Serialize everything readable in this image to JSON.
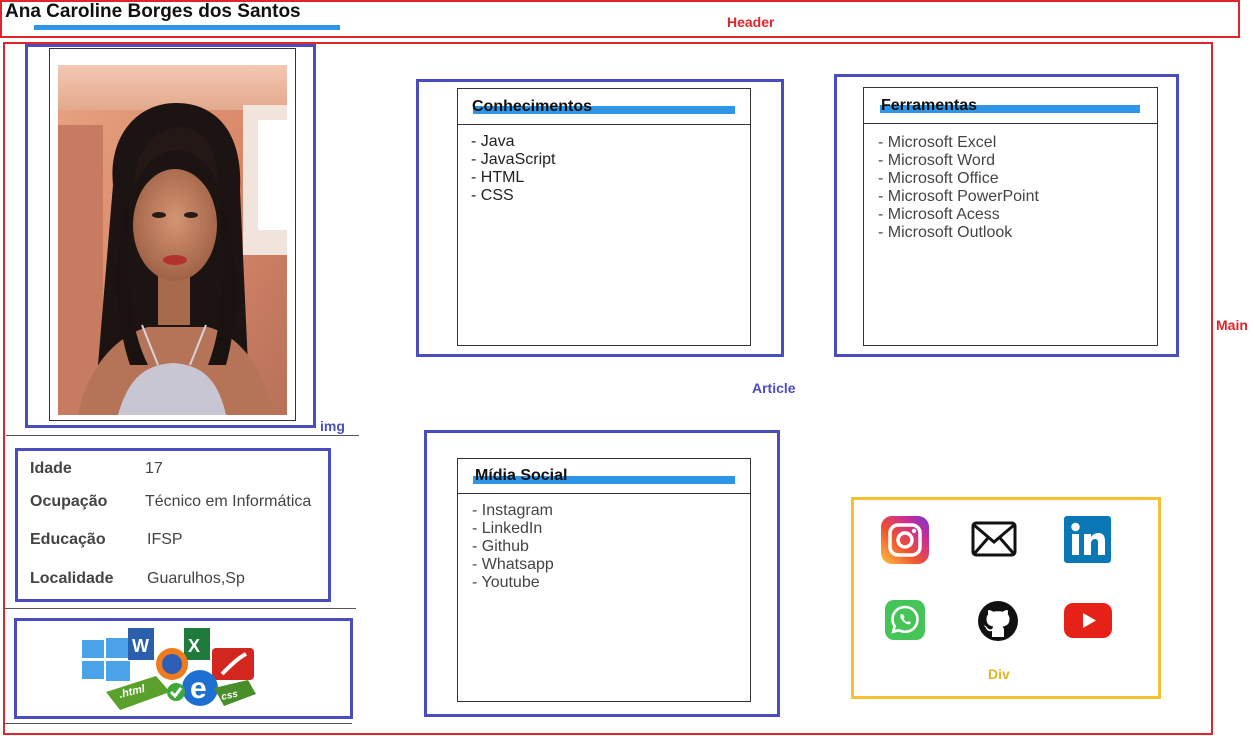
{
  "header": {
    "name": "Ana Caroline Borges dos Santos",
    "label": "Header"
  },
  "labels": {
    "main": "Main",
    "article": "Article",
    "img": "img",
    "div": "Div"
  },
  "info": [
    {
      "key": "Idade",
      "value": "17"
    },
    {
      "key": "Ocupação",
      "value": "Técnico em Informática"
    },
    {
      "key": "Educação",
      "value": "IFSP"
    },
    {
      "key": "Localidade",
      "value": "Guarulhos,Sp"
    }
  ],
  "cards": {
    "conhecimentos": {
      "title": "Conhecimentos",
      "items": [
        "- Java",
        "- JavaScript",
        "- HTML",
        "- CSS"
      ]
    },
    "ferramentas": {
      "title": "Ferramentas",
      "items": [
        "- Microsoft Excel",
        "- Microsoft Word",
        "- Microsoft Office",
        "- Microsoft PowerPoint",
        "- Microsoft Acess",
        "- Microsoft Outlook"
      ]
    },
    "midia": {
      "title": "Mídia Social",
      "items": [
        "- Instagram",
        "- LinkedIn",
        "- Github",
        "- Whatsapp",
        "- Youtube"
      ]
    }
  },
  "logos": {
    "word_letter": "W",
    "excel_letter": "X",
    "html_label": ".html",
    "css_label": "css"
  },
  "social_icons": [
    "instagram-icon",
    "mail-icon",
    "linkedin-icon",
    "whatsapp-icon",
    "github-icon",
    "youtube-icon"
  ],
  "colors": {
    "region_red": "#e0262b",
    "region_blue": "#4a4dbd",
    "region_yellow": "#f2c230",
    "accent_bar": "#2f95e6"
  }
}
